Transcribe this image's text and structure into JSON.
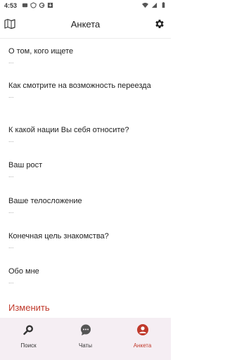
{
  "status_bar": {
    "time": "4:53",
    "left_icons": [
      "media-icon",
      "shield-icon",
      "g-icon",
      "download-icon"
    ],
    "right_icons": [
      "wifi-icon",
      "signal-icon",
      "battery-icon"
    ]
  },
  "header": {
    "title": "Анкета",
    "left_icon": "map-icon",
    "right_icon": "gear-icon"
  },
  "profile": {
    "sections": [
      {
        "question": "О том, кого ищете",
        "answer": "..."
      },
      {
        "question": "Как смотрите на возможность переезда",
        "answer": "..."
      },
      {
        "question": "К какой нации Вы себя относите?",
        "answer": "..."
      },
      {
        "question": "Ваш рост",
        "answer": "..."
      },
      {
        "question": "Ваше телосложение",
        "answer": "..."
      },
      {
        "question": "Конечная цель знакомства?",
        "answer": "..."
      },
      {
        "question": "Обо мне",
        "answer": "..."
      }
    ],
    "edit_label": "Изменить"
  },
  "bottom_nav": {
    "items": [
      {
        "label": "Поиск",
        "icon": "search-icon",
        "active": false
      },
      {
        "label": "Чаты",
        "icon": "chat-icon",
        "active": false
      },
      {
        "label": "Анкета",
        "icon": "profile-icon",
        "active": true
      }
    ]
  },
  "colors": {
    "accent": "#c0392b",
    "nav_background": "#f5eef3",
    "muted_text": "#9a9a9a"
  }
}
